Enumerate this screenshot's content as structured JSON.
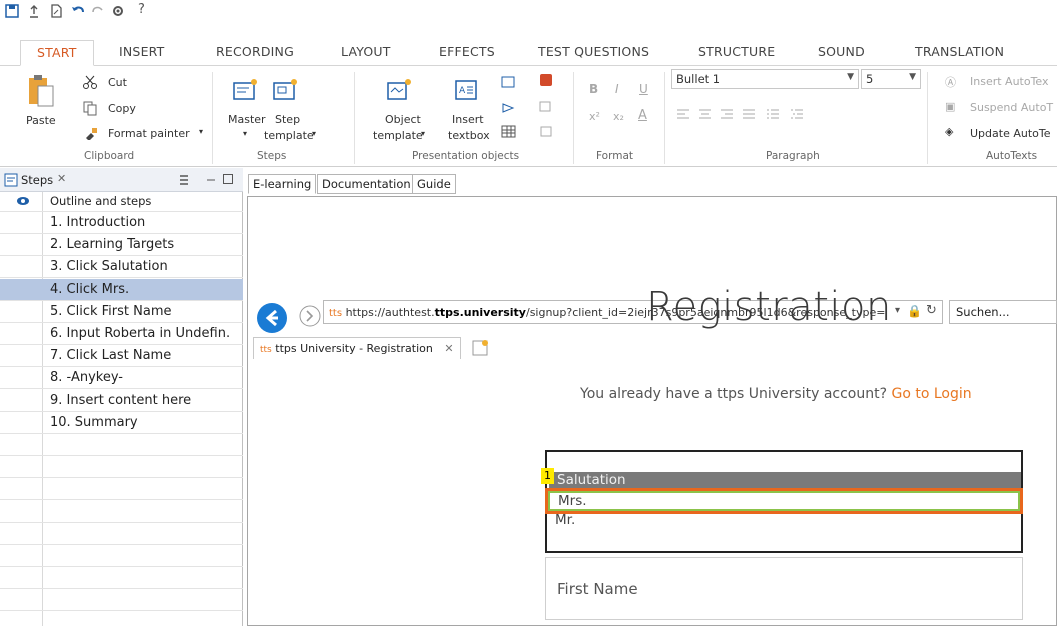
{
  "ribbon_tabs": [
    "START",
    "INSERT",
    "RECORDING",
    "LAYOUT",
    "EFFECTS",
    "TEST QUESTIONS",
    "STRUCTURE",
    "SOUND",
    "TRANSLATION"
  ],
  "clipboard": {
    "paste": "Paste",
    "cut": "Cut",
    "copy": "Copy",
    "format_painter": "Format painter",
    "group": "Clipboard"
  },
  "steps_group": {
    "master": "Master",
    "step": "Step",
    "template": "template",
    "group": "Steps"
  },
  "presentation": {
    "object": "Object",
    "object_template": "template",
    "insert": "Insert",
    "textbox": "textbox",
    "group": "Presentation objects"
  },
  "format": {
    "bold": "B",
    "italic": "I",
    "underline": "U",
    "group": "Format"
  },
  "paragraph": {
    "style": "Bullet 1",
    "size": "5",
    "group": "Paragraph"
  },
  "autotexts": {
    "insert": "Insert AutoTex",
    "suspend": "Suspend AutoT",
    "update": "Update AutoTe",
    "group": "AutoTexts"
  },
  "steps_panel": {
    "title": "Steps",
    "header": "Outline and steps",
    "items": [
      "1. Introduction",
      "2. Learning Targets",
      "3. Click Salutation",
      "4. Click Mrs.",
      "5. Click First Name",
      "6. Input Roberta in Undefin.",
      "7. Click Last Name",
      "8.  -Anykey-",
      "9. Insert content here",
      "10. Summary"
    ],
    "selected_index": 3
  },
  "content_tabs": [
    "E-learning",
    "Documentation",
    "Guide"
  ],
  "browser": {
    "url_prefix": "tts",
    "url_start": "https://authtest.",
    "url_bold": "ttps.university",
    "url_rest": "/signup?client_id=2iejr37s9pr5aeiqnmbr95l1d6&response_type=",
    "search_placeholder": "Suchen...",
    "tab_prefix": "tts",
    "tab_title": "ttps University - Registration"
  },
  "page": {
    "title": "Registration",
    "account_text": "You already have a ttps University account?",
    "login_link": "Go to Login",
    "badge": "1",
    "salutation": "Salutation",
    "options": [
      "Mrs.",
      "Mr."
    ],
    "first_name": "First Name"
  },
  "colors": {
    "accent": "#d65a24",
    "link": "#e87722",
    "selected_row": "#b6c7e2",
    "highlight_orange": "#e8671d",
    "highlight_green": "#8bc34a",
    "badge": "#ffea00",
    "back_button": "#1a7bd4"
  }
}
